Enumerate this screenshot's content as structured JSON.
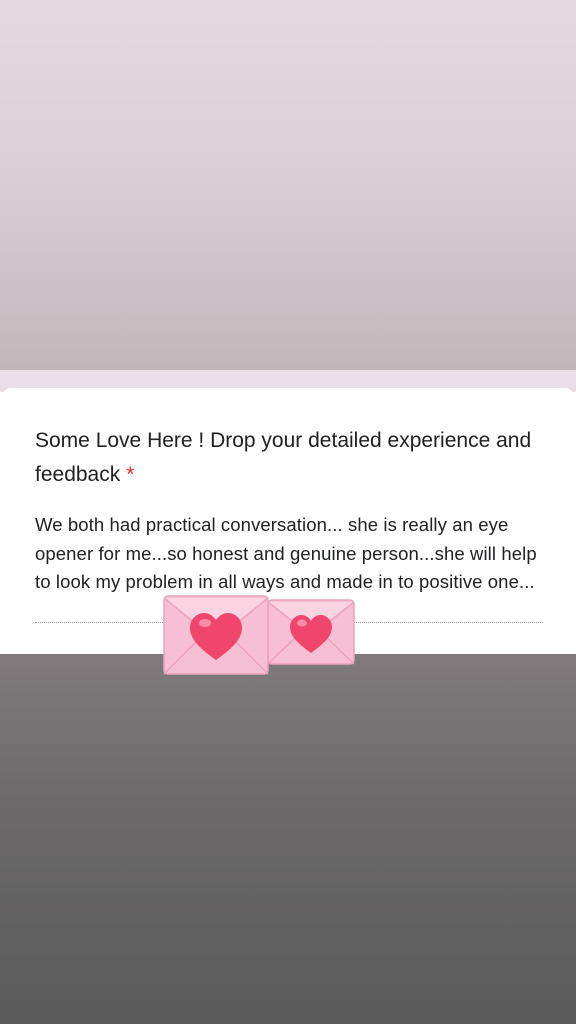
{
  "form": {
    "question": "Some Love Here ! Drop your detailed experience and feedback",
    "required_marker": "*",
    "answer": "We both had practical conversation... she is really an eye opener for me...so honest and genuine person...she will help to look my problem in all ways and made in to positive one..."
  },
  "stickers": [
    {
      "name": "love-letter-icon",
      "glyph": "💌"
    },
    {
      "name": "love-letter-icon",
      "glyph": "💌"
    }
  ],
  "colors": {
    "required": "#d93025",
    "envelope": "#f7bfd3",
    "heart": "#f0466d"
  }
}
